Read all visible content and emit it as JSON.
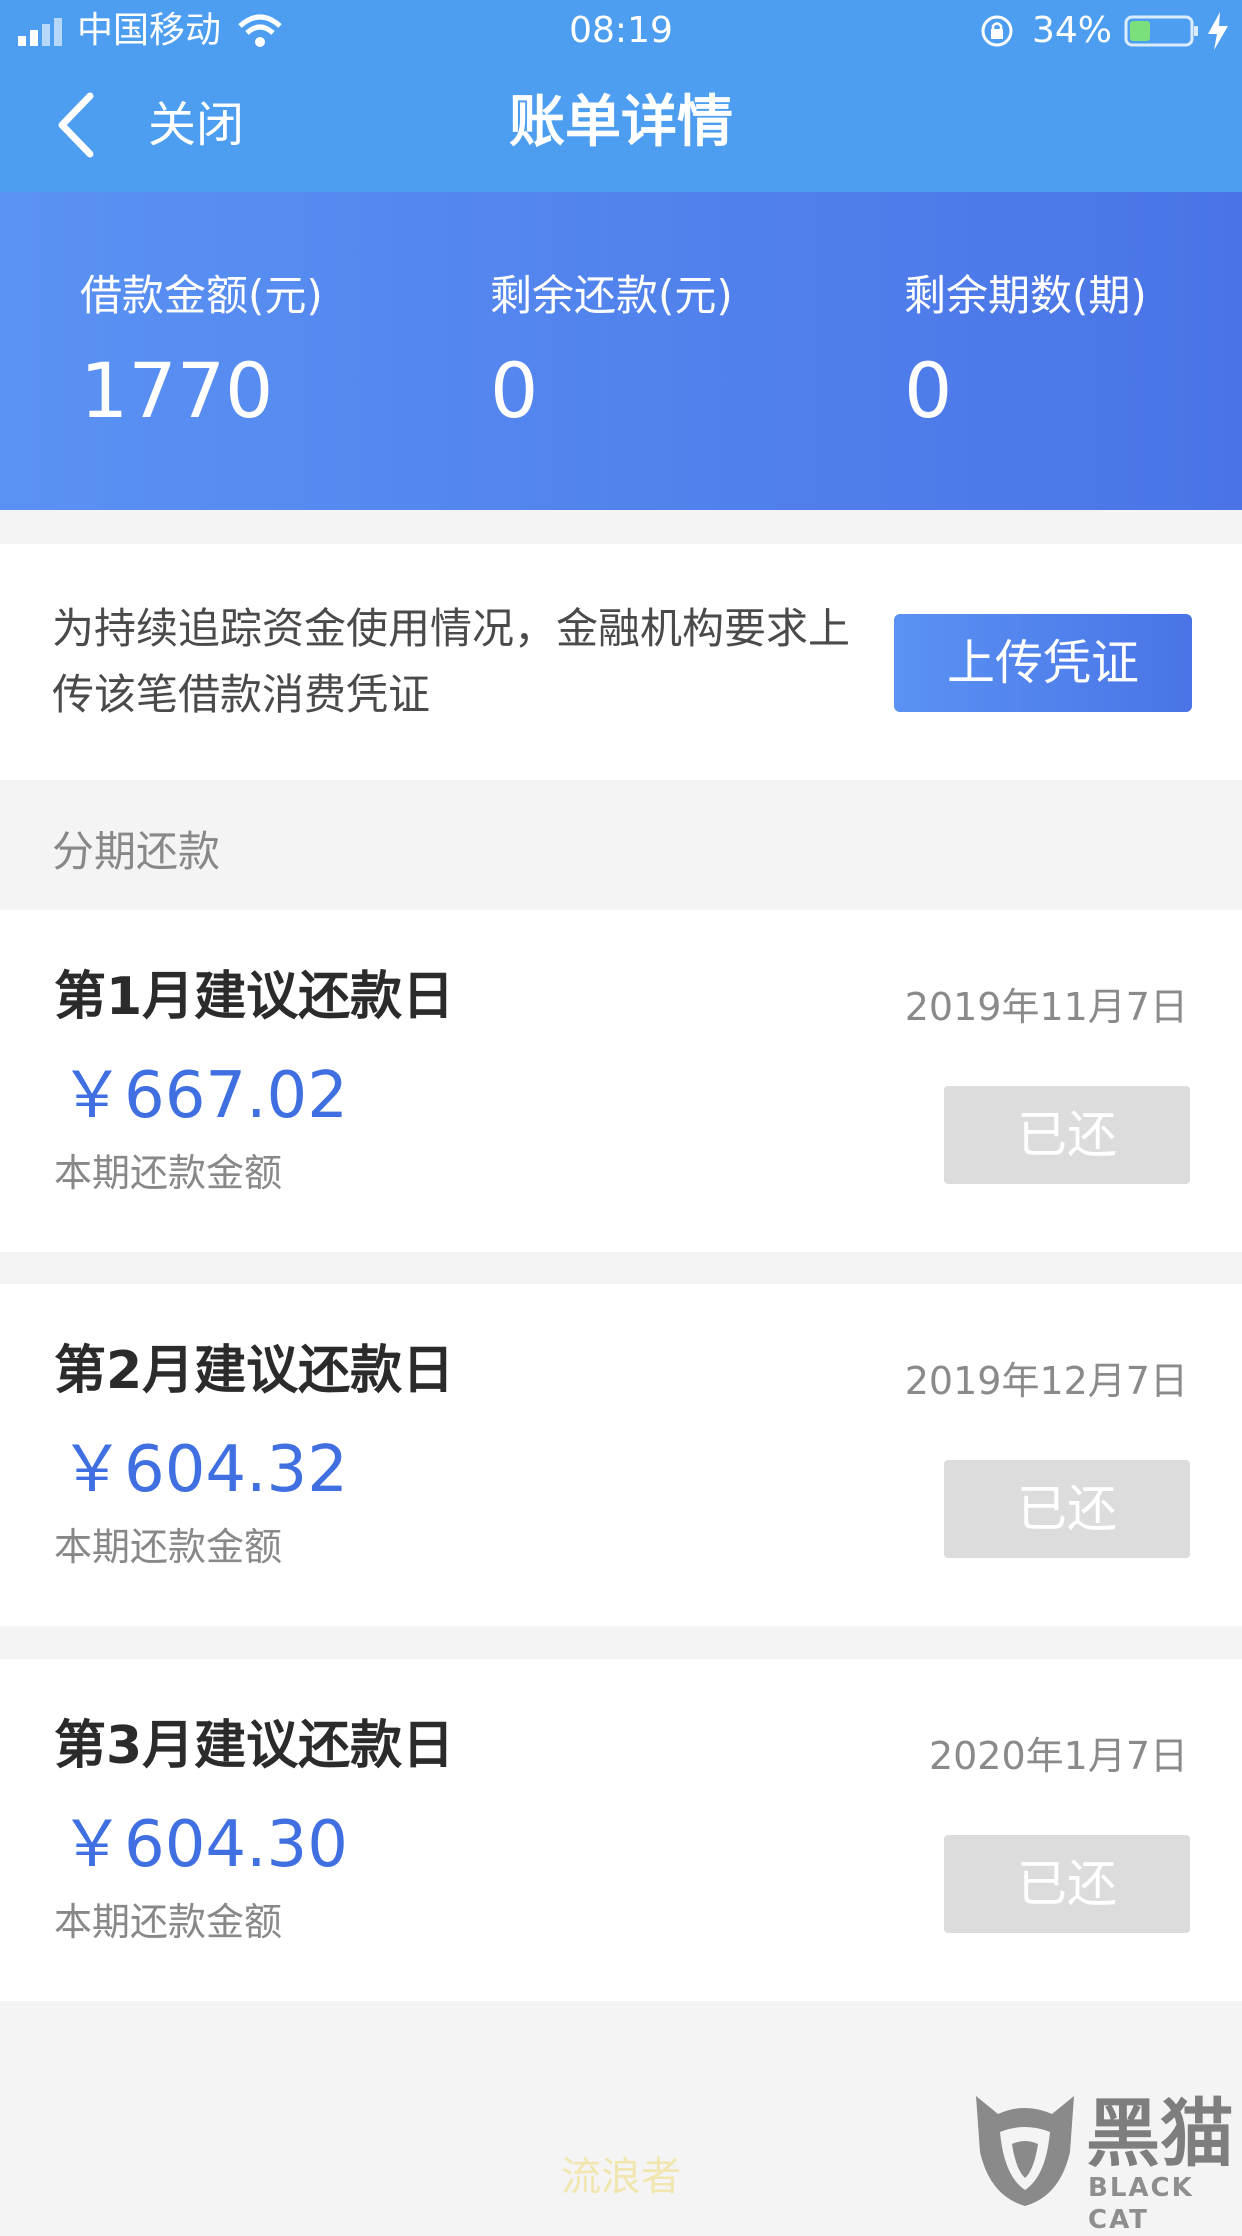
{
  "status_bar": {
    "carrier": "中国移动",
    "time": "08:19",
    "battery_percent": "34%",
    "icons": [
      "signal-icon",
      "wifi-icon",
      "rotation-lock-icon",
      "battery-icon",
      "charging-bolt-icon"
    ]
  },
  "nav": {
    "back_icon": "chevron-left-icon",
    "close_label": "关闭",
    "title": "账单详情"
  },
  "summary": {
    "items": [
      {
        "label": "借款金额(元)",
        "value": "1770"
      },
      {
        "label": "剩余还款(元)",
        "value": "0"
      },
      {
        "label": "剩余期数(期)",
        "value": "0"
      }
    ]
  },
  "notice": {
    "text": "为持续追踪资金使用情况，金融机构要求上传该笔借款消费凭证",
    "button_label": "上传凭证"
  },
  "installments": {
    "section_title": "分期还款",
    "items": [
      {
        "title": "第1月建议还款日",
        "date": "2019年11月7日",
        "amount": "￥667.02",
        "amount_label": "本期还款金额",
        "status": "已还"
      },
      {
        "title": "第2月建议还款日",
        "date": "2019年12月7日",
        "amount": "￥604.32",
        "amount_label": "本期还款金额",
        "status": "已还"
      },
      {
        "title": "第3月建议还款日",
        "date": "2020年1月7日",
        "amount": "￥604.30",
        "amount_label": "本期还款金额",
        "status": "已还"
      }
    ]
  },
  "watermark": {
    "center_text": "流浪者",
    "brand_cn": "黑猫",
    "brand_en": "BLACK CAT"
  },
  "colors": {
    "nav_blue": "#4d9ef0",
    "gradient_start": "#5a92f3",
    "gradient_end": "#4a74e6",
    "amount_blue": "#3f6fe0",
    "paid_gray": "#dcdcdc"
  }
}
